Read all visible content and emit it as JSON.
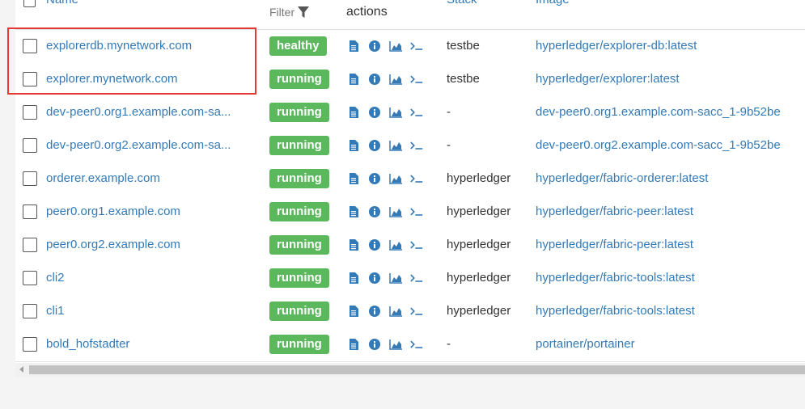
{
  "header": {
    "name": "Name",
    "filter": "Filter",
    "actions": "actions",
    "stack": "Stack",
    "image": "Image"
  },
  "rows": [
    {
      "name": "explorerdb.mynetwork.com",
      "status": "healthy",
      "stack": "testbe",
      "image": "hyperledger/explorer-db:latest"
    },
    {
      "name": "explorer.mynetwork.com",
      "status": "running",
      "stack": "testbe",
      "image": "hyperledger/explorer:latest"
    },
    {
      "name": "dev-peer0.org1.example.com-sa...",
      "status": "running",
      "stack": "-",
      "image": "dev-peer0.org1.example.com-sacc_1-9b52be"
    },
    {
      "name": "dev-peer0.org2.example.com-sa...",
      "status": "running",
      "stack": "-",
      "image": "dev-peer0.org2.example.com-sacc_1-9b52be"
    },
    {
      "name": "orderer.example.com",
      "status": "running",
      "stack": "hyperledger",
      "image": "hyperledger/fabric-orderer:latest"
    },
    {
      "name": "peer0.org1.example.com",
      "status": "running",
      "stack": "hyperledger",
      "image": "hyperledger/fabric-peer:latest"
    },
    {
      "name": "peer0.org2.example.com",
      "status": "running",
      "stack": "hyperledger",
      "image": "hyperledger/fabric-peer:latest"
    },
    {
      "name": "cli2",
      "status": "running",
      "stack": "hyperledger",
      "image": "hyperledger/fabric-tools:latest"
    },
    {
      "name": "cli1",
      "status": "running",
      "stack": "hyperledger",
      "image": "hyperledger/fabric-tools:latest"
    },
    {
      "name": "bold_hofstadter",
      "status": "running",
      "stack": "-",
      "image": "portainer/portainer"
    }
  ],
  "icons": [
    "logs-icon",
    "inspect-icon",
    "stats-icon",
    "console-icon"
  ],
  "colors": {
    "status": "#5cb85c",
    "link": "#337ab7",
    "highlight": "#e53935"
  }
}
